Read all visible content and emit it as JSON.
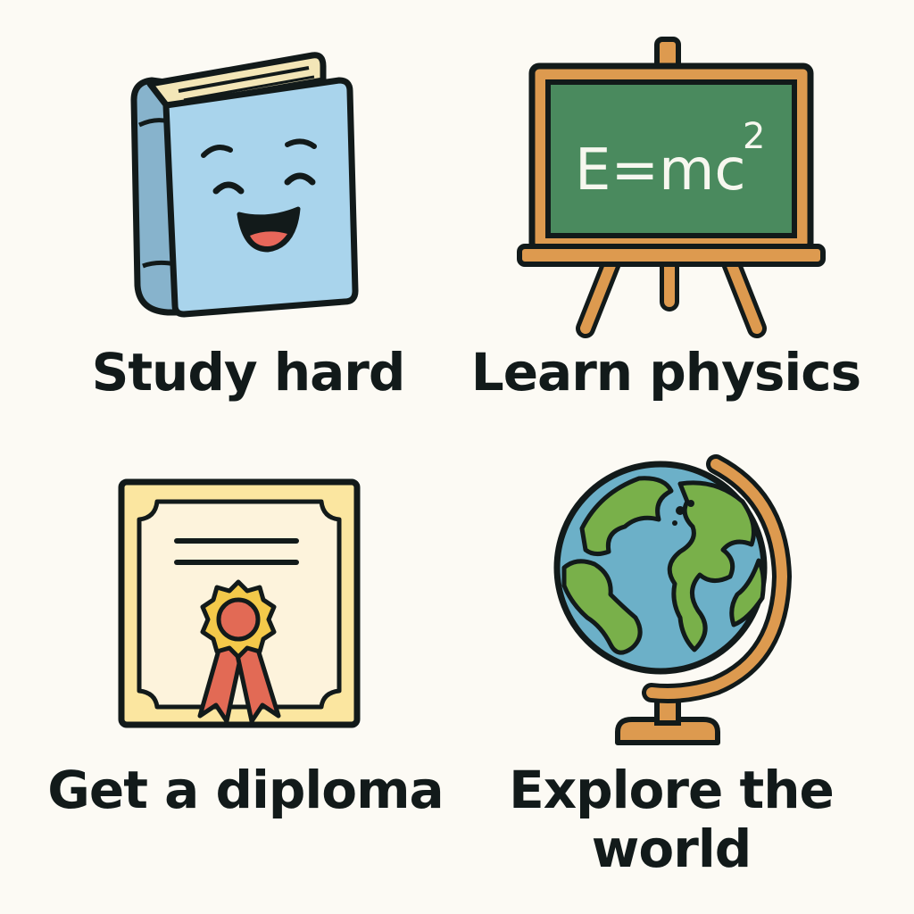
{
  "tiles": [
    {
      "caption": "Study hard",
      "icon": "smiling-book-icon"
    },
    {
      "caption": "Learn physics",
      "icon": "chalkboard-easel-icon",
      "board_text": "E=mc",
      "board_sup": "2"
    },
    {
      "caption": "Get a diploma",
      "icon": "diploma-certificate-icon"
    },
    {
      "caption": "Explore the world",
      "icon": "desk-globe-icon"
    }
  ],
  "colors": {
    "background": "#fcfaf4",
    "ink": "#121a1a",
    "book_cover": "#a9d4ec",
    "book_spine": "#87b3cc",
    "pages": "#f3e6b7",
    "board": "#4a8a5e",
    "wood": "#dd9a4f",
    "certificate": "#fbe6a0",
    "paper": "#fdf3dc",
    "seal": "#e26a55",
    "seal_ring": "#f3c94a",
    "ocean": "#6cb0c8",
    "land": "#79b04a"
  }
}
